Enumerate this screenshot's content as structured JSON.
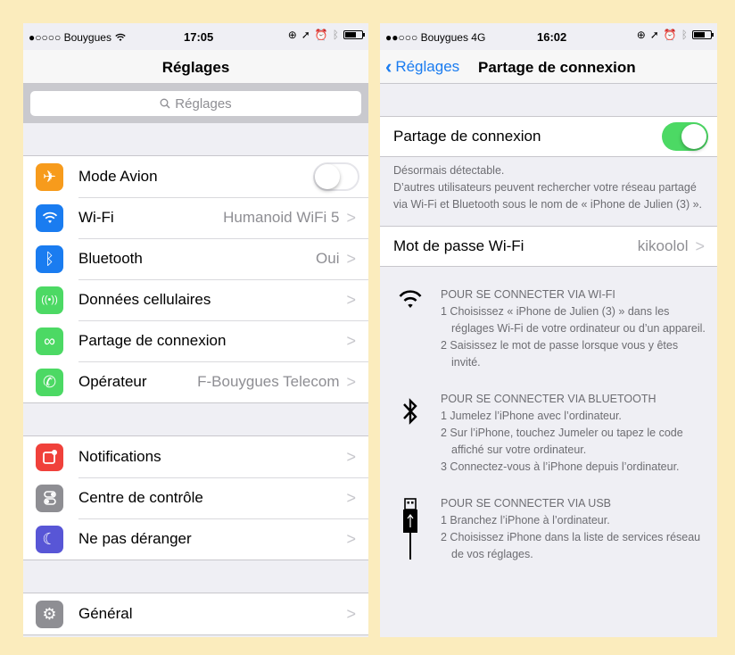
{
  "left": {
    "status": {
      "carrier": "●○○○○ Bouygues",
      "time": "17:05"
    },
    "title": "Réglages",
    "search_placeholder": "Réglages",
    "groups": [
      [
        {
          "label": "Mode Avion",
          "icon": "airplane-icon",
          "color": "#f79b1c",
          "glyph": "✈",
          "toggle": "off"
        },
        {
          "label": "Wi-Fi",
          "icon": "wifi-icon",
          "color": "#1a7cf0",
          "glyph": "",
          "value": "Humanoid WiFi 5"
        },
        {
          "label": "Bluetooth",
          "icon": "bluetooth-icon",
          "color": "#1a7cf0",
          "glyph": "ᛒ",
          "value": "Oui"
        },
        {
          "label": "Données cellulaires",
          "icon": "cellular-icon",
          "color": "#4cd964",
          "glyph": "((·))",
          "value": ""
        },
        {
          "label": "Partage de connexion",
          "icon": "hotspot-icon",
          "color": "#4cd964",
          "glyph": "∞",
          "value": ""
        },
        {
          "label": "Opérateur",
          "icon": "phone-icon",
          "color": "#4cd964",
          "glyph": "✆",
          "value": "F-Bouygues Telecom"
        }
      ],
      [
        {
          "label": "Notifications",
          "icon": "notifications-icon",
          "color": "#f0413b",
          "glyph": "▣",
          "value": ""
        },
        {
          "label": "Centre de contrôle",
          "icon": "control-center-icon",
          "color": "#8e8e93",
          "glyph": "⊜",
          "value": ""
        },
        {
          "label": "Ne pas déranger",
          "icon": "moon-icon",
          "color": "#5856d6",
          "glyph": "☾",
          "value": ""
        }
      ],
      [
        {
          "label": "Général",
          "icon": "gear-icon",
          "color": "#8e8e93",
          "glyph": "⚙",
          "value": ""
        }
      ]
    ]
  },
  "right": {
    "status": {
      "carrier": "●●○○○ Bouygues 4G",
      "time": "16:02"
    },
    "back_label": "Réglages",
    "title": "Partage de connexion",
    "hotspot_label": "Partage de connexion",
    "hotspot_on": true,
    "footer_line1": "Désormais détectable.",
    "footer_line2": "D’autres utilisateurs peuvent rechercher votre réseau partagé via Wi-Fi et Bluetooth sous le nom de « iPhone de Julien (3) ».",
    "password_label": "Mot de passe Wi-Fi",
    "password_value": "kikoolol",
    "wifi": {
      "title": "POUR SE CONNECTER VIA WI-FI",
      "steps": [
        "1 Choisissez « iPhone de Julien (3) » dans les réglages Wi-Fi de votre ordinateur ou d’un appareil.",
        "2 Saisissez le mot de passe lorsque vous y êtes invité."
      ]
    },
    "bluetooth": {
      "title": "POUR SE CONNECTER VIA BLUETOOTH",
      "steps": [
        "1 Jumelez l’iPhone avec l’ordinateur.",
        "2 Sur l’iPhone, touchez Jumeler ou tapez le code affiché sur votre ordinateur.",
        "3 Connectez-vous à l’iPhone depuis l’ordinateur."
      ]
    },
    "usb": {
      "title": "POUR SE CONNECTER VIA USB",
      "steps": [
        "1 Branchez l’iPhone à l’ordinateur.",
        "2 Choisissez iPhone dans la liste de services réseau de vos réglages."
      ]
    }
  }
}
